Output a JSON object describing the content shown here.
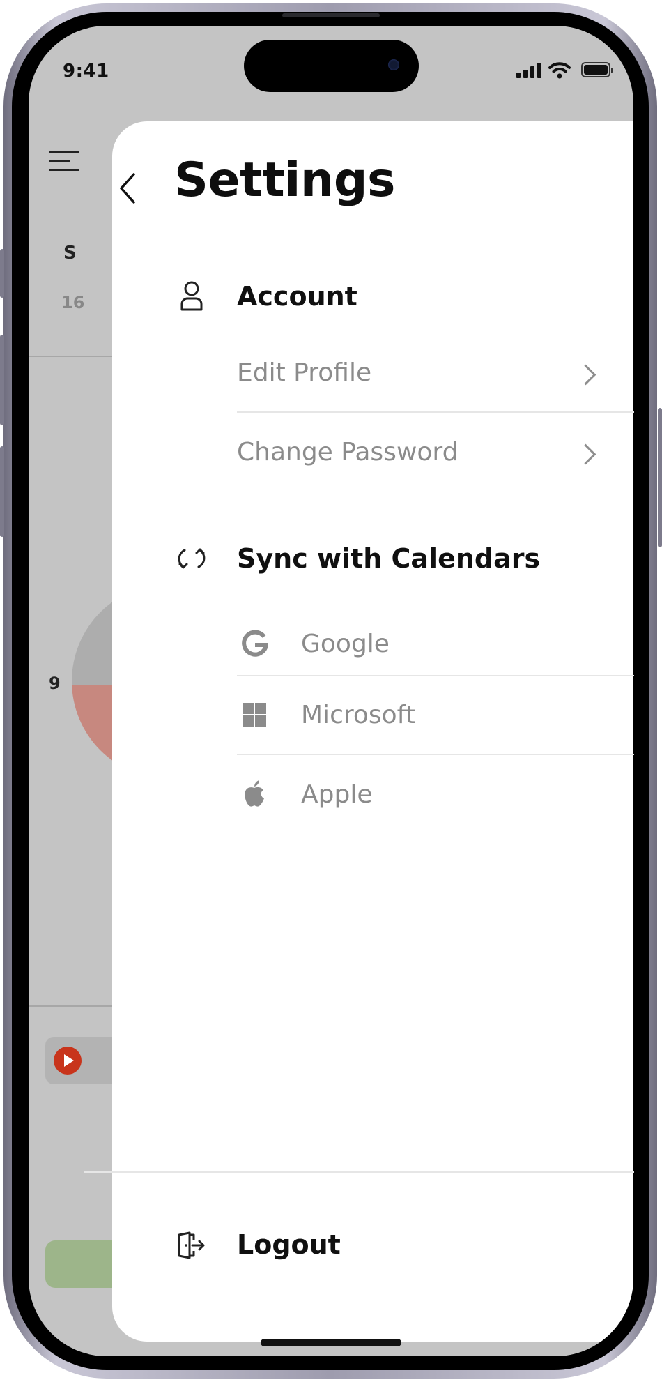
{
  "status_bar": {
    "time": "9:41"
  },
  "background_screen": {
    "day_letter": "S",
    "date_number": "16",
    "hour_label": "9"
  },
  "settings": {
    "title": "Settings",
    "account": {
      "label": "Account",
      "items": [
        {
          "label": "Edit Profile"
        },
        {
          "label": "Change Password"
        }
      ]
    },
    "sync": {
      "label": "Sync with Calendars",
      "providers": [
        {
          "label": "Google",
          "icon": "google-icon"
        },
        {
          "label": "Microsoft",
          "icon": "microsoft-icon"
        },
        {
          "label": "Apple",
          "icon": "apple-icon"
        }
      ]
    },
    "logout": {
      "label": "Logout"
    }
  },
  "colors": {
    "backdrop": "#c4c4c4",
    "panel": "#ffffff",
    "title_text": "#0e0e0e",
    "item_text": "#8b8b8b",
    "divider": "#e6e6e6",
    "play_red": "#c8341b",
    "event_green": "#9db58a",
    "chart_red": "#c7887f"
  }
}
